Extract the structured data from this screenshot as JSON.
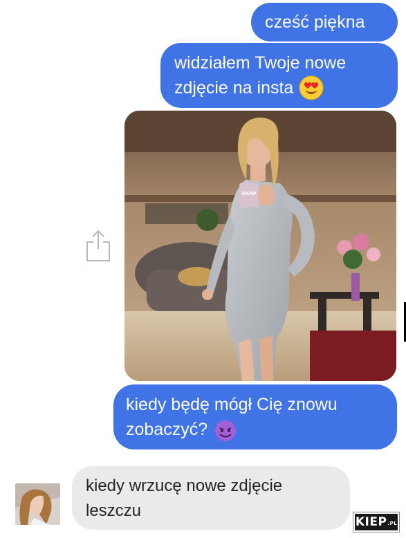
{
  "messages": {
    "m1": "cześć piękna",
    "m2_line1": "widziałem Twoje nowe",
    "m2_line2": "zdjęcie na insta",
    "m2_emoji": "heart-eyes-emoji",
    "m3_line1": "kiedy będę mógł Cię znowu",
    "m3_line2": "zobaczyć?",
    "m3_emoji": "smiling-devil-emoji",
    "reply_line1": "kiedy wrzucę nowe zdjęcie",
    "reply_line2": "leszczu"
  },
  "photo": {
    "phone_case_text": "SNAP"
  },
  "watermark": {
    "brand": "KIEP",
    "suffix": ".PL"
  },
  "colors": {
    "outgoing_bubble": "#3f73e6",
    "incoming_bubble": "#eaeaea"
  },
  "icons": {
    "share": "share-icon"
  }
}
